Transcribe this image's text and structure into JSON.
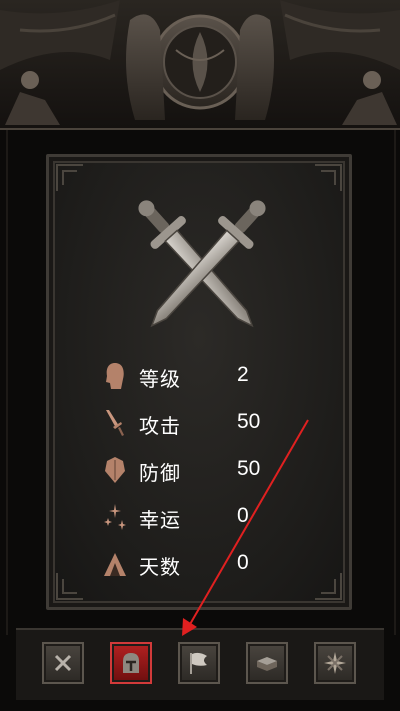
{
  "stats": [
    {
      "label": "等级",
      "value": "2",
      "icon": "head-icon"
    },
    {
      "label": "攻击",
      "value": "50",
      "icon": "dagger-icon"
    },
    {
      "label": "防御",
      "value": "50",
      "icon": "shield-icon"
    },
    {
      "label": "幸运",
      "value": "0",
      "icon": "sparkle-icon"
    },
    {
      "label": "天数",
      "value": "0",
      "icon": "tent-icon"
    }
  ],
  "toolbar": {
    "buttons": [
      "close-icon",
      "helmet-icon",
      "flag-icon",
      "book-icon",
      "map-icon"
    ],
    "active_index": 1
  },
  "colors": {
    "accent": "#b32121",
    "annotation_arrow": "#e02020",
    "text": "#ffffff"
  }
}
